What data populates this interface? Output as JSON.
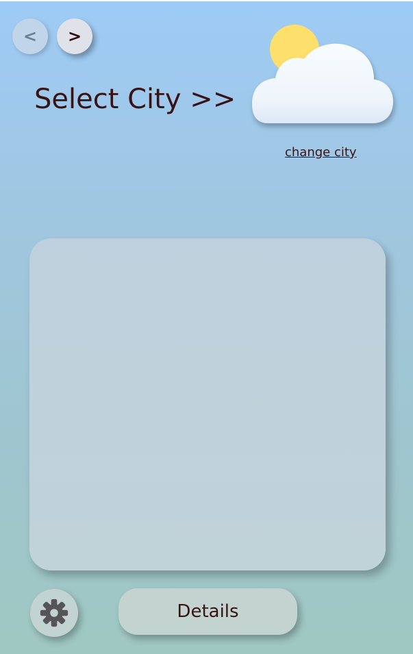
{
  "nav": {
    "back_label": "<",
    "forward_label": ">"
  },
  "header": {
    "city_title": "Select City >>",
    "change_city_link": "change city",
    "weather_icon": "partly-cloudy-icon"
  },
  "footer": {
    "settings_icon": "gear-icon",
    "details_label": "Details"
  },
  "colors": {
    "text": "#371314",
    "sun": "#fddf6b",
    "cloud": "#f3f9fd"
  }
}
